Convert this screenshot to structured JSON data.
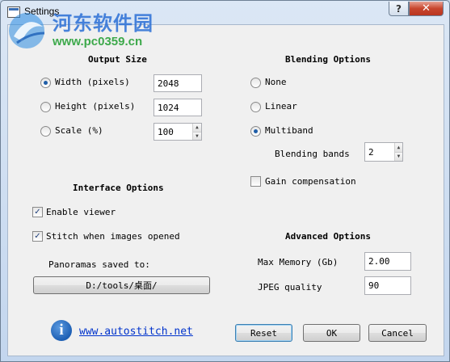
{
  "window": {
    "title": "Settings",
    "help_glyph": "?",
    "close_glyph": "✕"
  },
  "watermark": {
    "name": "河东软件园",
    "url": "www.pc0359.cn"
  },
  "output_size": {
    "heading": "Output Size",
    "width_label": "Width (pixels)",
    "width_value": "2048",
    "height_label": "Height (pixels)",
    "height_value": "1024",
    "scale_label": "Scale (%)",
    "scale_value": "100",
    "selected": "width"
  },
  "blending": {
    "heading": "Blending Options",
    "none_label": "None",
    "linear_label": "Linear",
    "multiband_label": "Multiband",
    "selected": "multiband",
    "bands_label": "Blending bands",
    "bands_value": "2",
    "gain_label": "Gain compensation",
    "gain_checked": false
  },
  "interface": {
    "heading": "Interface Options",
    "enable_viewer_label": "Enable viewer",
    "enable_viewer_checked": true,
    "stitch_label": "Stitch when images opened",
    "stitch_checked": true,
    "saved_to_label": "Panoramas saved to:",
    "path": "D:/tools/桌面/"
  },
  "advanced": {
    "heading": "Advanced Options",
    "max_memory_label": "Max Memory (Gb)",
    "max_memory_value": "2.00",
    "jpeg_label": "JPEG quality",
    "jpeg_value": "90"
  },
  "footer": {
    "info_glyph": "i",
    "link": "www.autostitch.net",
    "reset_label": "Reset",
    "ok_label": "OK",
    "cancel_label": "Cancel"
  },
  "colors": {
    "accent": "#1f5ea8",
    "link": "#0033cc",
    "close_button": "#c8462e"
  }
}
